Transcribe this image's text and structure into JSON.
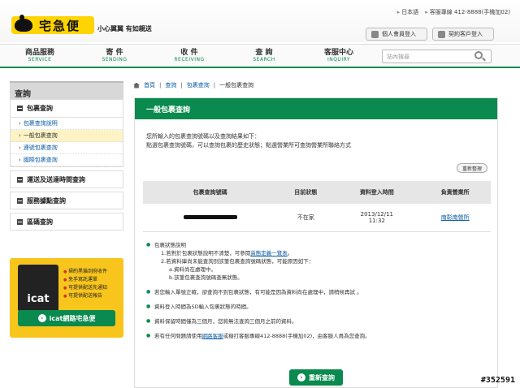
{
  "brand": {
    "name": "宅急便",
    "slogan": "小心翼翼 有如親送"
  },
  "top_links": {
    "lang": "日本語",
    "hotline": "客服專線 412-8888(手機加02)"
  },
  "top_buttons": {
    "member_login": "個人會員登入",
    "contract_login": "契約客戶登入"
  },
  "nav": [
    {
      "label": "商品服務",
      "en": "SERVICE"
    },
    {
      "label": "寄 件",
      "en": "SENDING"
    },
    {
      "label": "收 件",
      "en": "RECEIVING"
    },
    {
      "label": "查 詢",
      "en": "SEARCH"
    },
    {
      "label": "客服中心",
      "en": "INQUIRY"
    }
  ],
  "search": {
    "placeholder": "站內搜尋"
  },
  "sidebar": {
    "title": "查詢",
    "section1": "包裹查詢",
    "items": [
      "包裹查詢說明",
      "一般包裹查詢",
      "連號包裹查詢",
      "國際包裹查詢"
    ],
    "section2": "運送及送達時間查詢",
    "section3": "服務據點查詢",
    "section4": "區碼查詢"
  },
  "icat": {
    "logo": "icat",
    "features": [
      "掃約黑貓到府收件",
      "免手寫託運單",
      "可提供配送先通知",
      "可提供配送報告"
    ],
    "button": "icat網路宅急便"
  },
  "breadcrumb": [
    "首頁",
    "查詢",
    "包裹查詢",
    "一般包裹查詢"
  ],
  "panel": {
    "title": "一般包裹查詢",
    "intro_line1": "您所輸入的包裹查詢號碼以及查詢結果如下：",
    "intro_line2": "點選包裹查詢號碼，可以查詢包裹的歷史狀態；點選營業所可查詢營業所聯絡方式",
    "refresh": "重新整理",
    "table": {
      "headers": [
        "包裹查詢號碼",
        "目前狀態",
        "資料登入時間",
        "負責營業所"
      ],
      "row": {
        "status": "不在家",
        "date": "2013/12/11",
        "time": "11:32",
        "office": "南彰南營所"
      }
    },
    "notes": {
      "n1_title": "包裹狀態說明",
      "n1_a_pre": "1.若對於包裹狀態說明不清楚，可參閱",
      "n1_a_link": "貨態定義一覽表",
      "n1_a_post": "。",
      "n1_b": "2.若資料庫尚未能查詢到該筆包裹查詢號碼狀態，可能原因如下：",
      "n1_b_a": "a.資料尚在處理中。",
      "n1_b_b": "b.該筆包裹查詢號碼查無狀態。",
      "n2": "若您輸入單號正確，卻查詢不到包裹狀態，有可能是因為資料尚在處理中，請稍候再試 。",
      "n3": "資料登入時間為SD輸入包裹狀態的時間。",
      "n4": "資料保留時間僅為三個月，您將無法查詢三個月之前的資料。",
      "n5_pre": "若有任何問題請使用",
      "n5_link": "網路客服",
      "n5_post": "或撥打客服專線412-8888(手機加02)，由客服人員為您查詢。"
    },
    "requery": "重新查詢"
  },
  "watermark": "#352591"
}
